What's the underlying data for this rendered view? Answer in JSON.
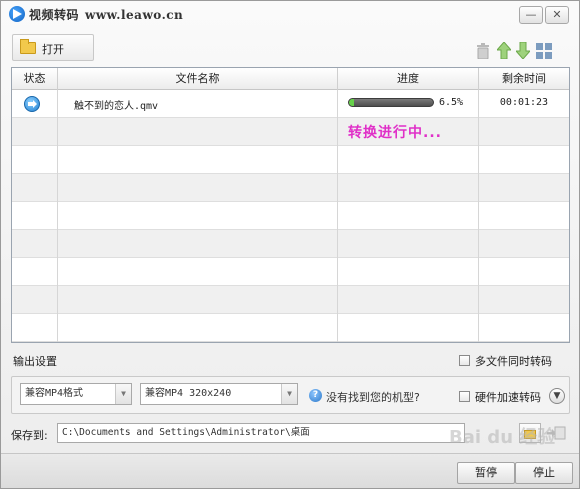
{
  "window": {
    "title": "视频转码",
    "url": "www.leawo.cn",
    "minimize": "—",
    "close": "✕"
  },
  "toolbar": {
    "open_label": "打开"
  },
  "table": {
    "headers": [
      "状态",
      "文件名称",
      "进度",
      "剩余时间"
    ],
    "rows": [
      {
        "name": "触不到的恋人.qmv",
        "progress_percent": 6.5,
        "progress_text": "6.5%",
        "remaining": "00:01:23"
      }
    ],
    "progress_message": "转换进行中..."
  },
  "output": {
    "section_label": "输出设置",
    "multi_file_label": "多文件同时转码",
    "format_select": "兼容MP4格式",
    "profile_select": "兼容MP4 320x240",
    "help_link": "没有找到您的机型?",
    "hw_accel_label": "硬件加速转码",
    "save_to_label": "保存到:",
    "save_path": "C:\\Documents and Settings\\Administrator\\桌面"
  },
  "buttons": {
    "pause": "暂停",
    "stop": "停止"
  },
  "watermark": "Bai du 经验",
  "colors": {
    "progress_fill": "#66d14a",
    "progress_message": "#e030c8"
  }
}
